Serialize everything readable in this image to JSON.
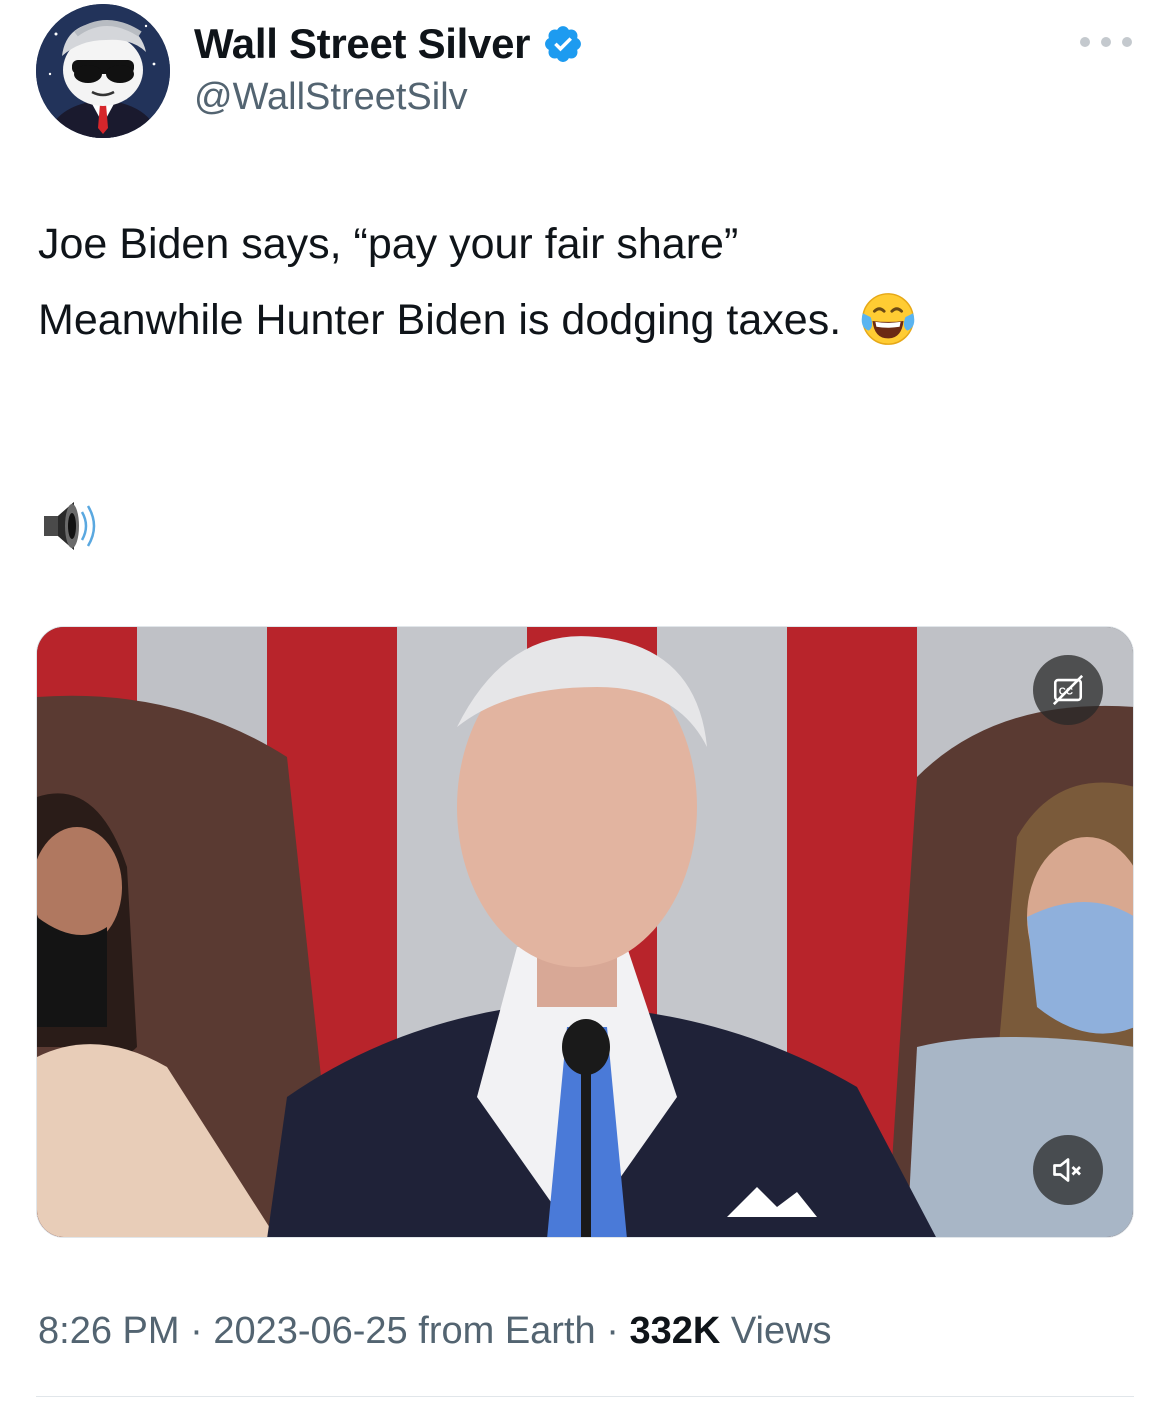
{
  "author": {
    "display_name": "Wall Street Silver",
    "handle": "@WallStreetSilv",
    "verified": true,
    "avatar_icon": "cartoon-man-sunglasses-avatar"
  },
  "more_icon": "ellipsis-icon",
  "tweet": {
    "line1": "Joe Biden says, “pay your fair share”",
    "line2": "Meanwhile Hunter Biden is dodging taxes.",
    "line2_emoji": "face-with-tears-of-joy",
    "line3_emoji": "speaker-high-volume"
  },
  "media": {
    "type": "video",
    "cc_icon": "closed-captions-off-icon",
    "mute_icon": "speaker-muted-icon"
  },
  "meta": {
    "time": "8:26 PM",
    "sep1": " · ",
    "date": "2023-06-25",
    "source": " from Earth",
    "sep2": " · ",
    "views_count": "332K",
    "views_label": " Views"
  },
  "colors": {
    "verified_blue": "#1d9bf0",
    "text_primary": "#0f1419",
    "text_secondary": "#536471"
  }
}
